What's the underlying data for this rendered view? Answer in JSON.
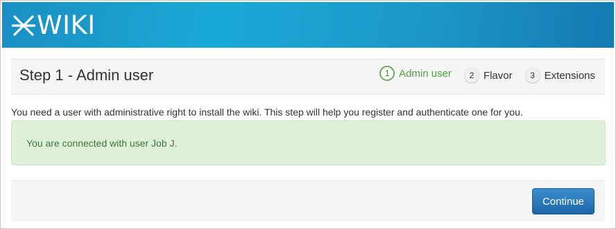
{
  "header": {
    "logo_text": "WIKI",
    "logo_icon": "xwiki-x-logo-icon",
    "gradient_colors": [
      "#1a8fc3",
      "#1aa9d6",
      "#1379b3"
    ]
  },
  "panel": {
    "title": "Step 1 - Admin user",
    "steps": [
      {
        "number": "1",
        "label": "Admin user",
        "active": true
      },
      {
        "number": "2",
        "label": "Flavor",
        "active": false
      },
      {
        "number": "3",
        "label": "Extensions",
        "active": false
      }
    ]
  },
  "intro_text": "You need a user with administrative right to install the wiki. This step will help you register and authenticate one for you.",
  "alert": {
    "text": "You are connected with user Job J.",
    "color": "#dff0d8"
  },
  "footer": {
    "continue_label": "Continue",
    "button_color": "#2a7ab9"
  }
}
